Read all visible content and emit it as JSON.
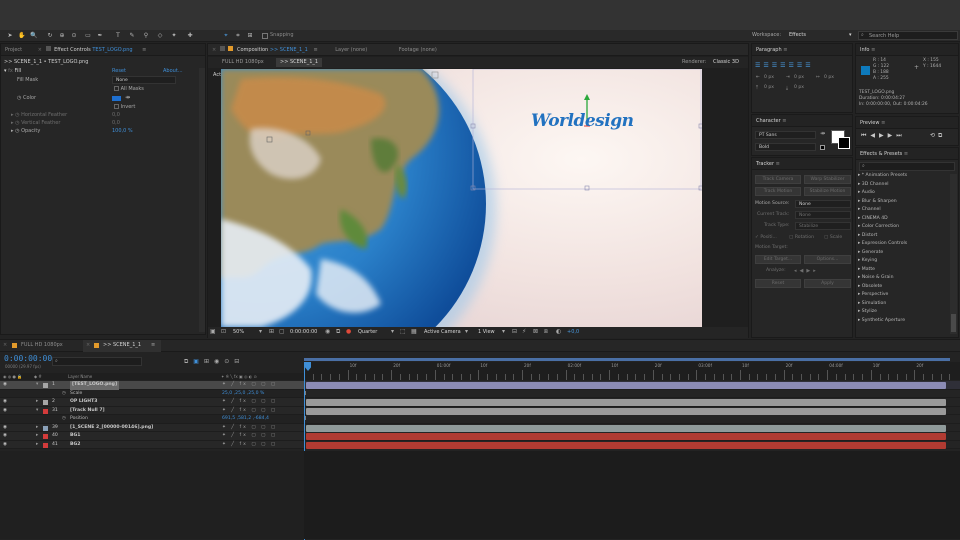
{
  "toolbar": {
    "snapping": "Snapping",
    "workspace_label": "Workspace:",
    "workspace_value": "Effects",
    "search_help": "Search Help"
  },
  "project": {
    "tab_project": "Project",
    "tab_effect_controls": "Effect Controls",
    "effect_layer": "TEST_LOGO.png",
    "breadcrumb": ">> SCENE_1_1 • TEST_LOGO.png",
    "fx_name": "Fill",
    "reset": "Reset",
    "about": "About...",
    "fill_mask_label": "Fill Mask",
    "fill_mask_value": "None",
    "all_masks": "All Masks",
    "color_label": "Color",
    "invert": "Invert",
    "horizontal_feather": "Horizontal Feather",
    "horizontal_feather_value": "0,0",
    "vertical_feather": "Vertical Feather",
    "vertical_feather_value": "0,0",
    "opacity_label": "Opacity",
    "opacity_value": "100,0 %"
  },
  "composition": {
    "tab_composition": "Composition",
    "comp_name": ">> SCENE_1_1",
    "tab_layer": "Layer (none)",
    "tab_footage": "Footage (none)",
    "sub_full_hd": "FULL HD 1080px",
    "sub_scene": ">> SCENE_1_1",
    "renderer_label": "Renderer:",
    "renderer_value": "Classic 3D",
    "active_camera": "Active Camera",
    "logo_text": "Worldesign",
    "zoom": "50%",
    "timecode": "0:00:00:00",
    "resolution": "Quarter",
    "camera": "Active Camera",
    "views": "1 View",
    "exposure": "+0,0"
  },
  "paragraph": {
    "title": "Paragraph",
    "values": [
      "0 px",
      "0 px",
      "0 px",
      "0 px",
      "0 px"
    ]
  },
  "character": {
    "title": "Character",
    "font": "PT Sans",
    "style": "Bold"
  },
  "tracker": {
    "title": "Tracker",
    "track_camera": "Track Camera",
    "warp_stabilizer": "Warp Stabilizer",
    "track_motion": "Track Motion",
    "stabilize_motion": "Stabilize Motion",
    "motion_source_label": "Motion Source:",
    "motion_source_value": "None",
    "current_track_label": "Current Track:",
    "current_track_value": "None",
    "track_type_label": "Track Type:",
    "track_type_value": "Stabilize",
    "position": "Positi...",
    "rotation": "Rotation",
    "scale": "Scale",
    "motion_target": "Motion Target:",
    "edit_target": "Edit Target...",
    "options": "Options...",
    "analyze": "Analyze:",
    "reset": "Reset",
    "apply": "Apply"
  },
  "info": {
    "title": "Info",
    "r": "R : 14",
    "g": "G : 122",
    "b": "B : 188",
    "a": "A : 255",
    "x": "X : 155",
    "y": "Y : 1644",
    "file": "TEST_LOGO.png",
    "duration": "Duration: 0:00:04:27",
    "in_out": "In: 0:00:00:00, Out: 0:00:04:26",
    "swatch": "#0e7abc"
  },
  "preview": {
    "title": "Preview"
  },
  "effects_presets": {
    "title": "Effects & Presets",
    "search_placeholder": "",
    "items": [
      "* Animation Presets",
      "3D Channel",
      "Audio",
      "Blur & Sharpen",
      "Channel",
      "CINEMA 4D",
      "Color Correction",
      "Distort",
      "Expression Controls",
      "Generate",
      "Keying",
      "Matte",
      "Noise & Grain",
      "Obsolete",
      "Perspective",
      "Simulation",
      "Stylize",
      "Synthetic Aperture"
    ]
  },
  "timeline": {
    "tab_full_hd": "FULL HD 1080px",
    "tab_scene": ">> SCENE_1_1",
    "timecode": "0:00:00:00",
    "frame_info": "00000 (29.97 fps)",
    "layer_name_header": "Layer Name",
    "ruler": [
      "0f",
      "10f",
      "20f",
      "01:00f",
      "10f",
      "20f",
      "02:00f",
      "10f",
      "20f",
      "03:00f",
      "10f",
      "20f",
      "04:00f",
      "10f",
      "20f"
    ],
    "layers": [
      {
        "num": "1",
        "name": "[TEST_LOGO.png]",
        "label": "#a6a6a6",
        "bar": "#8b8bb5",
        "selected": true
      },
      {
        "num": "",
        "name": "Scale",
        "sub": true,
        "value": "25,0 ,25,0 ,25,0 %"
      },
      {
        "num": "2",
        "name": "OP LIGHT3",
        "label": "#a6a6a6",
        "bar": "#9a9a9a"
      },
      {
        "num": "31",
        "name": "[Track Null 7]",
        "label": "#d33b3b",
        "bar": "#9a9a9a"
      },
      {
        "num": "",
        "name": "Position",
        "sub": true,
        "value": "691,5 ,581,2 ,-684,4"
      },
      {
        "num": "39",
        "name": "[1_SCENE 2_[00000-00146].png]",
        "label": "#8aa0b8",
        "bar": "#8f9a9a"
      },
      {
        "num": "40",
        "name": "BG1",
        "label": "#d33b3b",
        "bar": "#b03b32"
      },
      {
        "num": "41",
        "name": "BG2",
        "label": "#d33b3b",
        "bar": "#b03b32"
      }
    ]
  }
}
